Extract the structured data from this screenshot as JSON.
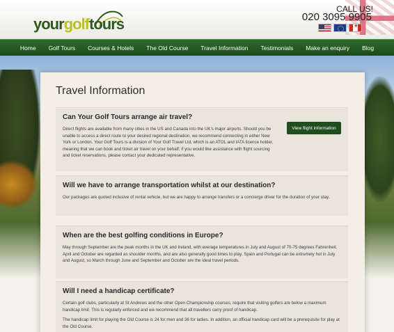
{
  "header": {
    "logo": {
      "your": "your",
      "golf": "golf",
      "tours": "tours"
    },
    "call_label": "CALL US!",
    "phone": "020 3095 9905",
    "flags": [
      "us-flag",
      "eu-flag",
      "canada-flag"
    ]
  },
  "nav": {
    "items": [
      "Home",
      "Golf Tours",
      "Courses & Hotels",
      "The Old Course",
      "Travel Information",
      "Testimonials",
      "Make an enquiry",
      "Blog"
    ]
  },
  "page": {
    "title": "Travel Information"
  },
  "faqs": [
    {
      "question": "Can Your Golf Tours arrange air travel?",
      "paragraphs": [
        "Direct flights are available from many cities in the US and Canada into the UK's major airports. Should you be unable to access a direct route to your desired regional destination, we recommend connecting in either New York or London. Your Golf Tours is a division of Your Golf Travel Ltd, which is an ATOL and IATA licence holder, meaning that we can book and ticket air travel on your behalf; if you would like assistance with flight sourcing and ticket reservations, please contact your dedicated representative."
      ],
      "button": "View flight information"
    },
    {
      "question": "Will we have to arrange transportation whilst at our destination?",
      "paragraphs": [
        "Our packages are quoted inclusive of rental vehicle, but we are happy to arrange transfers or a concierge driver for the duration of your stay."
      ]
    },
    {
      "question": "When are the best golfing conditions in Europe?",
      "paragraphs": [
        "May through September are the peak months in the UK and Ireland, with average temperatures in July and August of 70-75 degrees Fahrenheit. April and October are regarded as shoulder months, and are also generally good times to play. Spain and Portugal can be extremely hot in July and August, so March through June and September and October are the ideal travel periods."
      ]
    },
    {
      "question": "Will I need a handicap certificate?",
      "paragraphs": [
        "Certain golf clubs, particularly at St Andrews and the other Open Championship courses, require that visiting golfers are below a maximum handicap limit. This is regularly enforced and we recommend that all travellers carry proof of handicap.",
        "The handicap limit for playing the Old Course is 24 for men and 36 for ladies. In addition, an official handicap card will be a prerequisite for play at the Old Course."
      ]
    }
  ],
  "colors": {
    "nav_green": "#1c4a19",
    "logo_green": "#2e5a1e",
    "logo_lime": "#b7c21a",
    "button_green": "#1f4d1d"
  }
}
